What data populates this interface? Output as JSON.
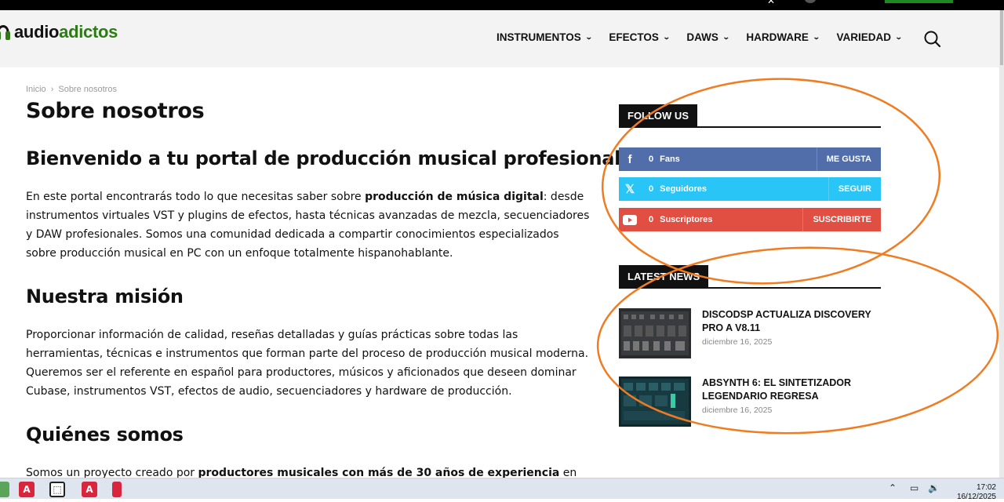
{
  "site": {
    "logo_part1": "audio",
    "logo_part2": "adictos",
    "brand_green": "#2e7a17"
  },
  "nav": {
    "items": [
      {
        "label": "INSTRUMENTOS"
      },
      {
        "label": "EFECTOS"
      },
      {
        "label": "DAWS"
      },
      {
        "label": "HARDWARE"
      },
      {
        "label": "VARIEDAD"
      }
    ]
  },
  "breadcrumb": {
    "home": "Inicio",
    "separator": "›",
    "current": "Sobre nosotros"
  },
  "main": {
    "title": "Sobre nosotros",
    "h_welcome": "Bienvenido a tu portal de producción musical profesional",
    "p1_a": "En este portal encontrarás todo lo que necesitas saber sobre ",
    "p1_b": "producción de música digital",
    "p1_c": ": desde instrumentos virtuales VST y plugins de efectos, hasta técnicas avanzadas de mezcla, secuenciadores y DAW profesionales. Somos una comunidad dedicada a compartir conocimientos especializados sobre producción musical en PC con un enfoque totalmente hispanohablante.",
    "h_mission": "Nuestra misión",
    "p2": "Proporcionar información de calidad, reseñas detalladas y guías prácticas sobre todas las herramientas, técnicas e instrumentos que forman parte del proceso de producción musical moderna. Queremos ser el referente en español para productores, músicos y aficionados que deseen dominar Cubase, instrumentos VST, efectos de audio, secuenciadores y hardware de producción.",
    "h_who": "Quiénes somos",
    "p3_a": "Somos un proyecto creado por ",
    "p3_b": "productores musicales con más de 30 años de experiencia",
    "p3_c": " en"
  },
  "sidebar": {
    "follow_title": "FOLLOW US",
    "social": [
      {
        "icon": "facebook-icon",
        "count": "0",
        "label": "Fans",
        "action": "ME GUSTA",
        "color": "#516eab"
      },
      {
        "icon": "x-icon",
        "count": "0",
        "label": "Seguidores",
        "action": "SEGUIR",
        "color": "#29c5f6"
      },
      {
        "icon": "youtube-icon",
        "count": "0",
        "label": "Suscriptores",
        "action": "SUSCRIBIRTE",
        "color": "#e14e42"
      }
    ],
    "news_title": "LATEST NEWS",
    "news": [
      {
        "title": "DISCODSP ACTUALIZA DISCOVERY PRO A V8.11",
        "date": "diciembre 16, 2025"
      },
      {
        "title": "ABSYNTH 6: EL SINTETIZADOR LEGENDARIO REGRESA",
        "date": "diciembre 16, 2025"
      }
    ]
  },
  "annotation": {
    "oval_color": "#f07c22"
  },
  "taskbar": {
    "time": "17:02",
    "date": "16/12/2025"
  }
}
